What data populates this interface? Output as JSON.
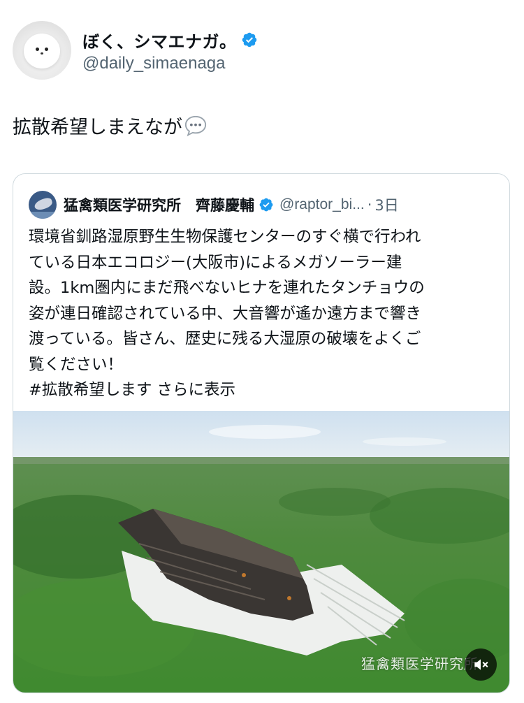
{
  "author": {
    "display_name": "ぼく、シマエナガ。",
    "handle": "@daily_simaenaga",
    "verified_icon": "verified-badge-icon"
  },
  "tweet": {
    "text": "拡散希望しまえなが",
    "trailing_icon": "speech-bubble-icon"
  },
  "quote": {
    "author_name": "猛禽類医学研究所　齊藤慶輔",
    "handle": "@raptor_bi...",
    "separator": "·",
    "time": "3日",
    "body_lines": [
      "環境省釧路湿原野生生物保護センターのすぐ横で行われ",
      "ている日本エコロジー(大阪市)によるメガソーラー建",
      "設。1km圏内にまだ飛べないヒナを連れたタンチョウの",
      "姿が連日確認されている中、大音響が遙か遠方まで響き",
      "渡っている。皆さん、歴史に残る大湿原の破壊をよくご",
      "覧ください！"
    ],
    "hashtag": "#拡散希望します",
    "show_more": "さらに表示",
    "media": {
      "watermark": "猛禽類医学研究所",
      "mute_icon": "speaker-muted-icon"
    }
  },
  "colors": {
    "verified_blue": "#1d9bf0",
    "secondary_text": "#536471",
    "border": "#cfd9de"
  }
}
